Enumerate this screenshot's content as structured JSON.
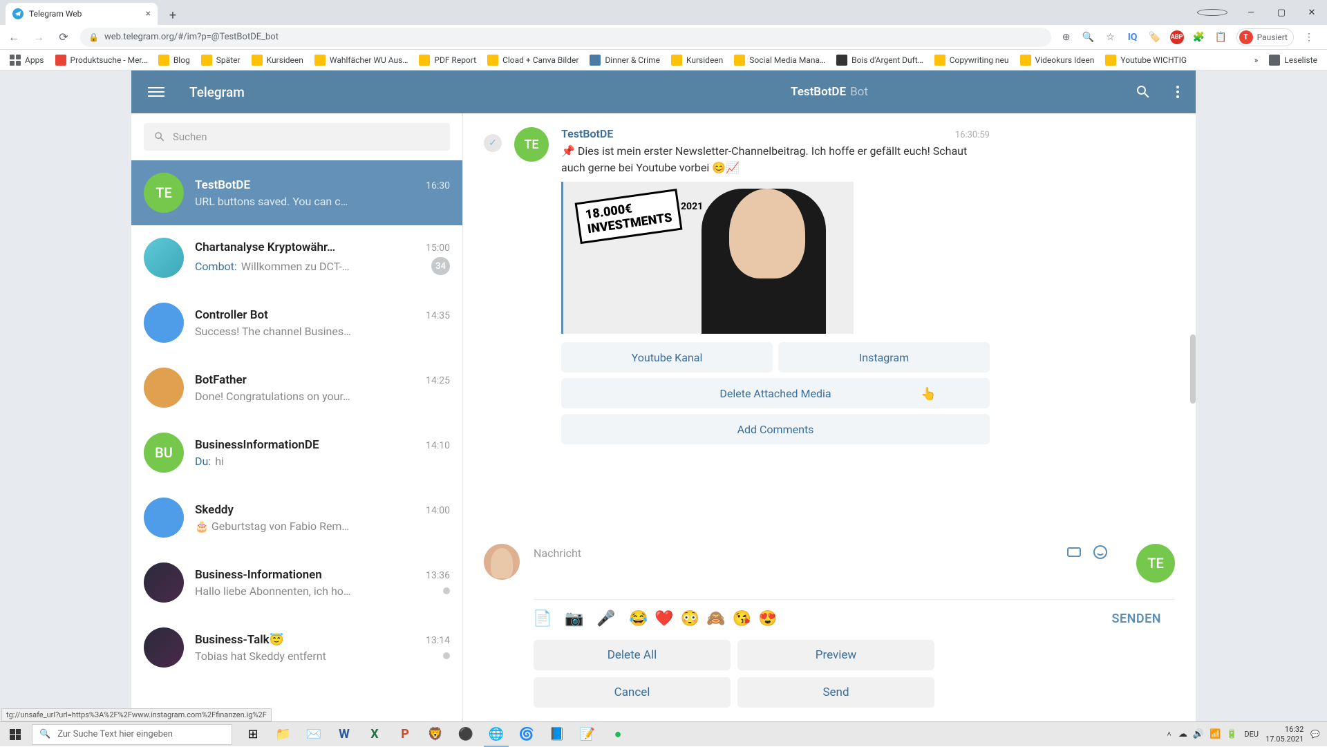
{
  "browser": {
    "tab_title": "Telegram Web",
    "url": "web.telegram.org/#/im?p=@TestBotDE_bot",
    "profile_label": "Pausiert",
    "profile_initial": "T",
    "abp_badge": "ABP",
    "bookmarks": [
      "Apps",
      "Produktsuche - Mer…",
      "Blog",
      "Später",
      "Kursideen",
      "Wahlfächer WU Aus…",
      "PDF Report",
      "Cload + Canva Bilder",
      "Dinner & Crime",
      "Kursideen",
      "Social Media Mana…",
      "Bois d'Argent Duft…",
      "Copywriting neu",
      "Videokurs Ideen",
      "Youtube WICHTIG"
    ],
    "reading_list": "Leseliste",
    "status_link": "tg://unsafe_url?url=https%3A%2F%2Fwww.instagram.com%2Ffinanzen.ig%2F"
  },
  "telegram": {
    "app_title": "Telegram",
    "search_placeholder": "Suchen",
    "chat_header": {
      "name": "TestBotDE",
      "type": "Bot"
    },
    "chats": [
      {
        "initials": "TE",
        "avatar_class": "green",
        "name": "TestBotDE",
        "preview": "URL buttons saved. You can c…",
        "time": "16:30",
        "active": true
      },
      {
        "initials": "",
        "avatar_class": "teal",
        "name": "Chartanalyse Kryptowähr…",
        "preview_prefix": "Combot:",
        "preview": "Willkommen zu DCT-…",
        "time": "15:00",
        "badge": "34"
      },
      {
        "initials": "",
        "avatar_class": "blue",
        "name": "Controller Bot",
        "preview": "Success! The channel Busines…",
        "time": "14:35"
      },
      {
        "initials": "",
        "avatar_class": "orange",
        "name": "BotFather",
        "preview": "Done! Congratulations on your…",
        "time": "14:25"
      },
      {
        "initials": "BU",
        "avatar_class": "green",
        "name": "BusinessInformationDE",
        "preview_prefix": "Du:",
        "preview": "hi",
        "time": "14:10"
      },
      {
        "initials": "",
        "avatar_class": "blue",
        "name": "Skeddy",
        "preview": "🎂 Geburtstag von Fabio Rem…",
        "time": "14:00"
      },
      {
        "initials": "",
        "avatar_class": "dark",
        "name": "Business-Informationen",
        "preview": "Hallo liebe Abonnenten, ich ho…",
        "time": "13:36",
        "dot": true
      },
      {
        "initials": "",
        "avatar_class": "dark",
        "name": "Business-Talk😇",
        "preview": "Tobias hat Skeddy entfernt",
        "time": "13:14",
        "dot": true
      }
    ],
    "message": {
      "author": "TestBotDE",
      "author_initials": "TE",
      "time": "16:30:59",
      "text": "📌 Dies ist mein erster Newsletter-Channelbeitrag. Ich hoffe er gefällt euch! Schaut auch gerne bei Youtube vorbei 😊📈",
      "image": {
        "sticker_line1": "18.000€",
        "sticker_line2": "INVESTMENTS",
        "sticker_year": "2021"
      },
      "buttons": [
        [
          "Youtube Kanal",
          "Instagram"
        ],
        [
          "Delete Attached Media"
        ],
        [
          "Add Comments"
        ]
      ]
    },
    "compose": {
      "placeholder": "Nachricht",
      "send_initials": "TE",
      "emojis": [
        "😂",
        "❤️",
        "😳",
        "🙈",
        "😘",
        "😍"
      ],
      "send_label": "SENDEN",
      "actions": [
        [
          "Delete All",
          "Preview"
        ],
        [
          "Cancel",
          "Send"
        ]
      ]
    }
  },
  "taskbar": {
    "search_placeholder": "Zur Suche Text hier eingeben",
    "lang": "DEU",
    "time": "16:32",
    "date": "17.05.2021"
  }
}
